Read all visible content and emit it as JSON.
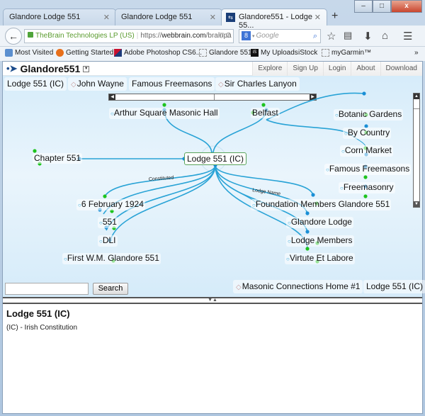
{
  "browser": {
    "tabs": [
      {
        "title": "Glandore Lodge 551",
        "active": false
      },
      {
        "title": "Glandore Lodge 551",
        "active": false
      },
      {
        "title": "Glandore551 - Lodge 55...",
        "active": true
      }
    ],
    "new_tab_symbol": "+",
    "window_controls": {
      "minimize": "–",
      "maximize": "□",
      "close": "x"
    },
    "address": {
      "identity": "TheBrain Technologies LP (US)",
      "url_prefix": "https://",
      "url_domain": "webbrain.com",
      "url_rest": "/brainpa",
      "icons": "▽ C"
    },
    "search": {
      "engine_icon": "8",
      "placeholder": "Google"
    },
    "toolbar_icons": [
      "star-icon",
      "clipboard-icon",
      "download-icon",
      "home-icon",
      "menu-icon"
    ],
    "bookmarks": [
      {
        "label": "Most Visited",
        "icon": "most-visited-icon"
      },
      {
        "label": "Getting Started",
        "icon": "firefox-icon"
      },
      {
        "label": "Adobe Photoshop CS6...",
        "icon": "photoshop-icon"
      },
      {
        "label": "Glandore 551",
        "icon": "page-icon"
      },
      {
        "label": "My Uploads",
        "icon": "istock-icon"
      },
      {
        "label": "iStock",
        "icon": null
      },
      {
        "label": "myGarmin™",
        "icon": "page-icon"
      }
    ],
    "bookmarks_overflow": "»"
  },
  "app": {
    "brain_name": "Glandore551",
    "menu": [
      "Explore",
      "Sign Up",
      "Login",
      "About",
      "Download"
    ],
    "pins_top": [
      {
        "label": "Lodge 551 (IC)",
        "up": false
      },
      {
        "label": "John Wayne",
        "up": true
      },
      {
        "label": "Famous Freemasons",
        "up": false
      },
      {
        "label": "Sir Charles Lanyon",
        "up": true
      }
    ],
    "pins_bottom": [
      {
        "label": "Masonic Connections Home #1",
        "up": true
      },
      {
        "label": "Lodge 551 (IC)",
        "up": false
      }
    ],
    "search": {
      "value": "",
      "button": "Search"
    },
    "plex": {
      "center": "Lodge 551 (IC)",
      "parents": [
        "Arthur Square Masonic Hall",
        "Belfast"
      ],
      "jumps": [
        "Chapter 551"
      ],
      "belfast_children": [
        "Botanic Gardens",
        "By Country",
        "Corn Market",
        "Famous Freemasons",
        "Freemasonry"
      ],
      "children_left": [
        "6 February 1924",
        "551",
        "DLI",
        "First W.M. Glandore 551"
      ],
      "children_right": [
        "Foundation Members Glandore 551",
        "Glandore Lodge",
        "Lodge Members",
        "Virtute Et Labore"
      ],
      "link_labels": [
        "Constituted",
        "Lodge Name"
      ]
    },
    "notes": {
      "title": "Lodge 551 (IC)",
      "text": "(IC) - Irish Constitution"
    },
    "colors": {
      "link": "#29a3d6",
      "parent_dot": "#1ec31e",
      "child_dot": "#1a8fd6",
      "center_border": "#5aa35a"
    }
  }
}
